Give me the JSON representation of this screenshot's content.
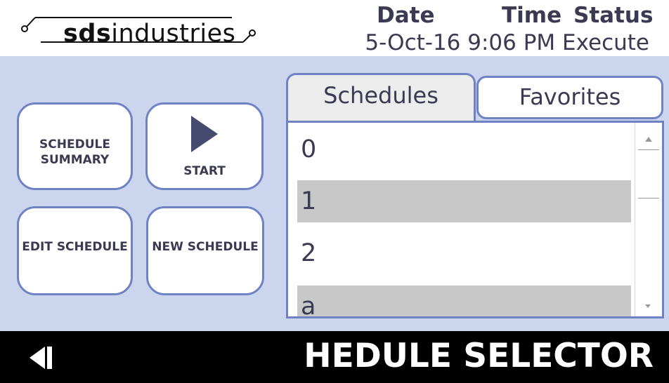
{
  "header": {
    "logo_bold": "sds",
    "logo_light": "industries",
    "labels": {
      "date": "Date",
      "time": "Time",
      "status": "Status"
    },
    "values_line": "5-Oct-16 9:06 PM Execute"
  },
  "buttons": {
    "schedule_summary": "SCHEDULE SUMMARY",
    "start": "START",
    "edit_schedule": "EDIT SCHEDULE",
    "new_schedule": "NEW SCHEDULE"
  },
  "tabs": {
    "schedules": "Schedules",
    "favorites": "Favorites"
  },
  "schedule_list": {
    "items": [
      "0",
      "1",
      "2",
      "a"
    ]
  },
  "footer": {
    "title": "HEDULE SELECTOR"
  },
  "icons": {
    "play": "play-icon",
    "back": "back-arrow-icon",
    "scroll_up": "scroll-up-arrow-icon",
    "scroll_down": "scroll-down-arrow-icon"
  },
  "colors": {
    "accent_border": "#6f82c4",
    "panel_background": "#ccd5ee",
    "alt_row": "#c8c8c8",
    "text": "#3a3a52",
    "footer_background": "#000000"
  }
}
